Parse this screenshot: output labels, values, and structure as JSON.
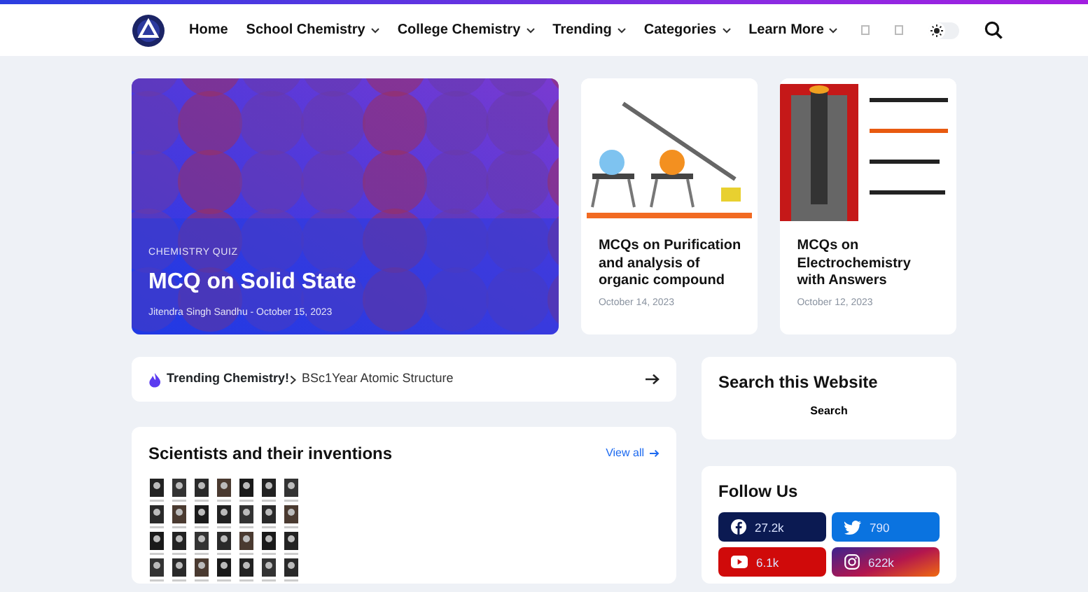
{
  "nav": {
    "items": [
      {
        "label": "Home",
        "dropdown": false
      },
      {
        "label": "School Chemistry",
        "dropdown": true
      },
      {
        "label": "College Chemistry",
        "dropdown": true
      },
      {
        "label": "Trending",
        "dropdown": true
      },
      {
        "label": "Categories",
        "dropdown": true
      },
      {
        "label": "Learn More",
        "dropdown": true
      }
    ],
    "dark_mode": false
  },
  "hero": {
    "category": "CHEMISTRY QUIZ",
    "title": "MCQ on Solid State",
    "byline": "Jitendra Singh Sandhu - October 15, 2023"
  },
  "posts": [
    {
      "kind": "apparatus",
      "title": "MCQs on Purification and analysis of organic compound",
      "date": "October 14, 2023"
    },
    {
      "kind": "cell",
      "title": "MCQs on Electrochemistry with Answers",
      "date": "October 12, 2023"
    }
  ],
  "trending": {
    "label": "Trending Chemistry!",
    "text": "BSc1Year Atomic Structure"
  },
  "scientists": {
    "title": "Scientists and their inventions",
    "link": "View all"
  },
  "search": {
    "title": "Search this Website",
    "button": "Search"
  },
  "follow": {
    "title": "Follow Us",
    "items": [
      {
        "kind": "facebook",
        "count": "27.2k"
      },
      {
        "kind": "twitter",
        "count": "790"
      },
      {
        "kind": "youtube",
        "count": "6.1k"
      },
      {
        "kind": "instagram",
        "count": "622k"
      }
    ]
  }
}
